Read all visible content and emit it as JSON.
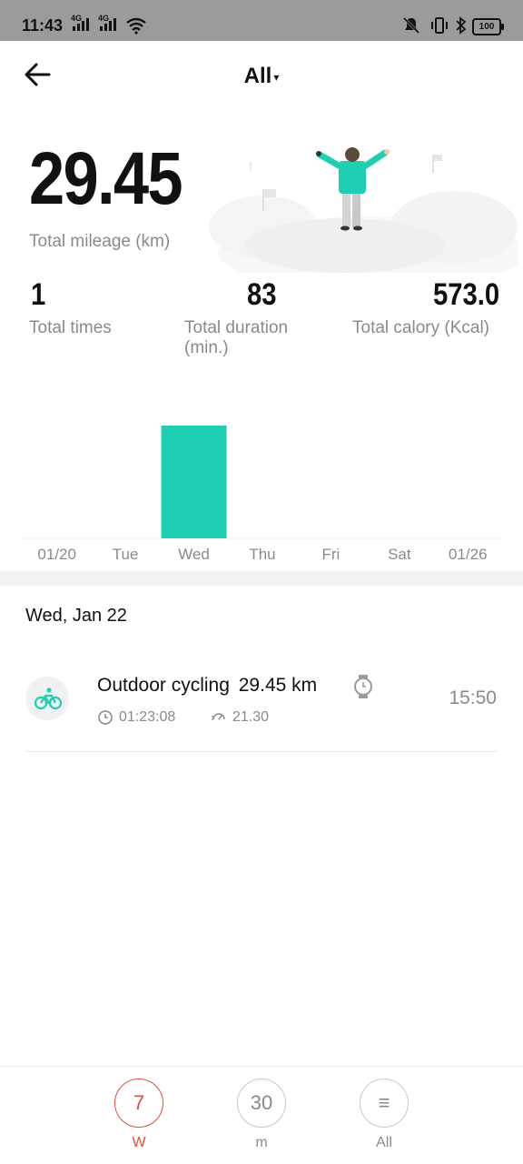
{
  "status_bar": {
    "time": "11:43",
    "sim1": "4G",
    "sim2": "4G",
    "battery": "100"
  },
  "header": {
    "title": "All",
    "caret": "▾"
  },
  "summary": {
    "total_mileage_value": "29.45",
    "total_mileage_label": "Total mileage (km)",
    "total_times_value": "1",
    "total_times_label": "Total times",
    "total_duration_value": "83",
    "total_duration_label": "Total duration (min.)",
    "total_calory_value": "573.0",
    "total_calory_label": "Total calory (Kcal)"
  },
  "chart_data": {
    "type": "bar",
    "categories": [
      "01/20",
      "Tue",
      "Wed",
      "Thu",
      "Fri",
      "Sat",
      "01/26"
    ],
    "values": [
      0,
      0,
      29.45,
      0,
      0,
      0,
      0
    ],
    "color": "#1ecfb2",
    "ylim": [
      0,
      29.45
    ]
  },
  "list": {
    "date_header": "Wed, Jan 22",
    "records": [
      {
        "title": "Outdoor cycling",
        "distance": "29.45 km",
        "time_of_day": "15:50",
        "duration": "01:23:08",
        "speed": "21.30",
        "icon": "cycling-icon",
        "device_icon": "watch-icon"
      }
    ]
  },
  "bottom_nav": {
    "items": [
      {
        "badge": "7",
        "label": "W",
        "active": true
      },
      {
        "badge": "30",
        "label": "m",
        "active": false
      },
      {
        "badge": "≡",
        "label": "All",
        "active": false
      }
    ]
  },
  "colors": {
    "accent": "#1ecfb2",
    "active_nav": "#e74c3c",
    "status_bar_bg": "#9b9b9b",
    "muted_text": "#8a8a8a"
  }
}
